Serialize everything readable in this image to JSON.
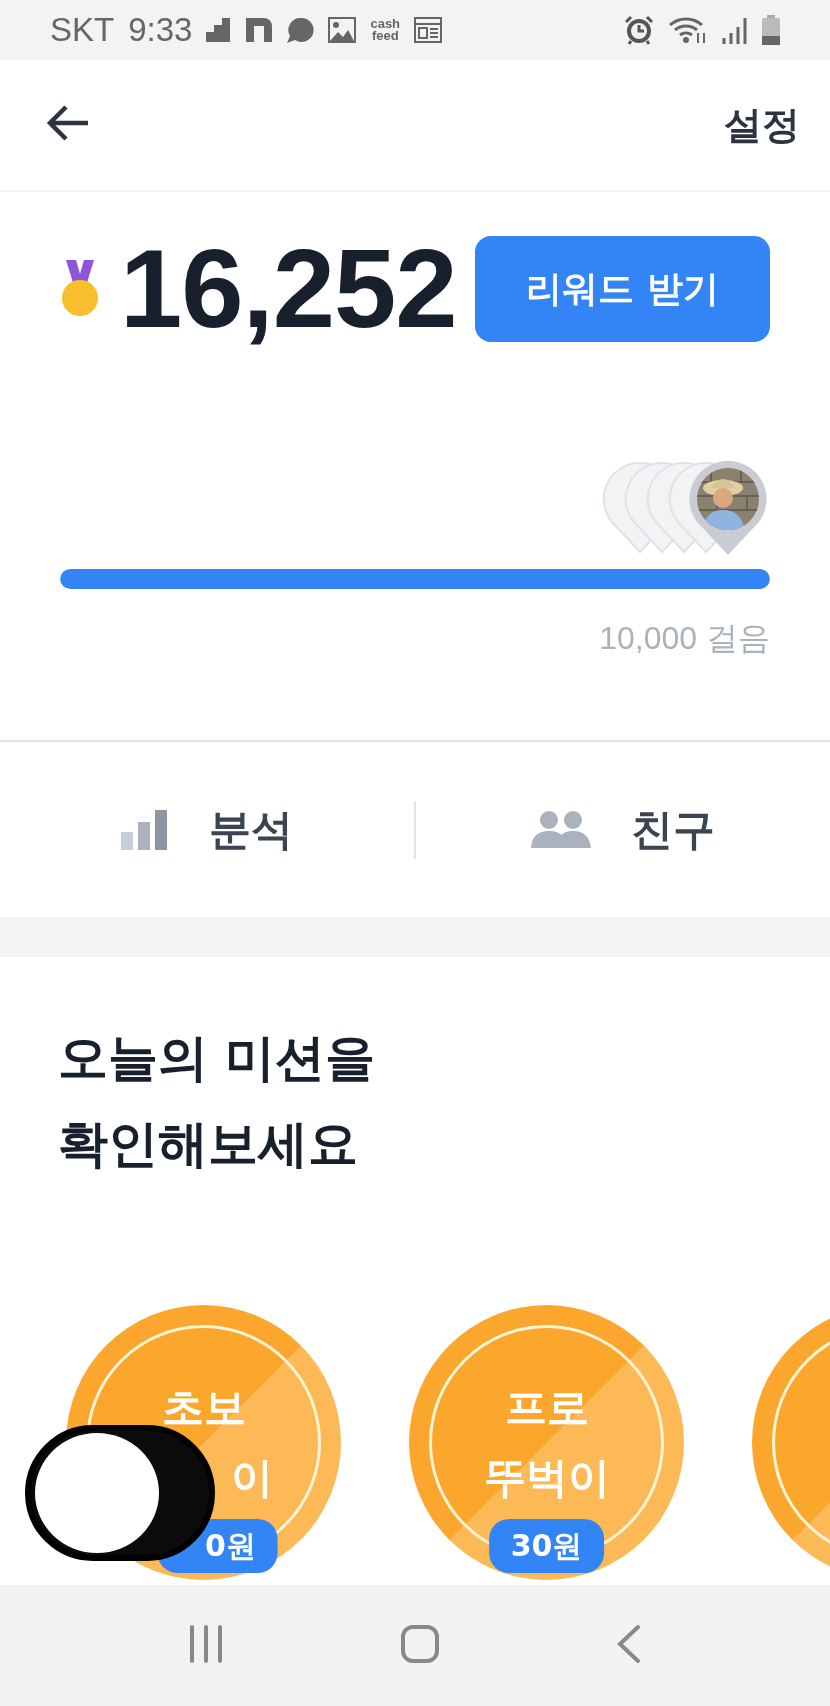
{
  "status_bar": {
    "carrier": "SKT",
    "time": "9:33",
    "app_text_icon": [
      "cash",
      "feed"
    ]
  },
  "header": {
    "action": "설정"
  },
  "summary": {
    "steps": "16,252",
    "reward_button": "리워드 받기",
    "progress": {
      "level": 1
    },
    "goal": "10,000 걸음"
  },
  "tabs": [
    {
      "label": "분석",
      "kind": "chart"
    },
    {
      "label": "친구",
      "kind": "friends"
    }
  ],
  "missions": {
    "title": [
      "오늘의 미션을",
      "확인해보세요"
    ],
    "badges": [
      {
        "kind": "covered",
        "title": "초보",
        "subtitle": "이",
        "reward": "0원"
      },
      {
        "kind": "full",
        "title": "프로",
        "subtitle": "뚜벅이",
        "reward": "30원"
      },
      {
        "kind": "edge"
      }
    ]
  },
  "floating_toggle": {
    "on": false
  }
}
